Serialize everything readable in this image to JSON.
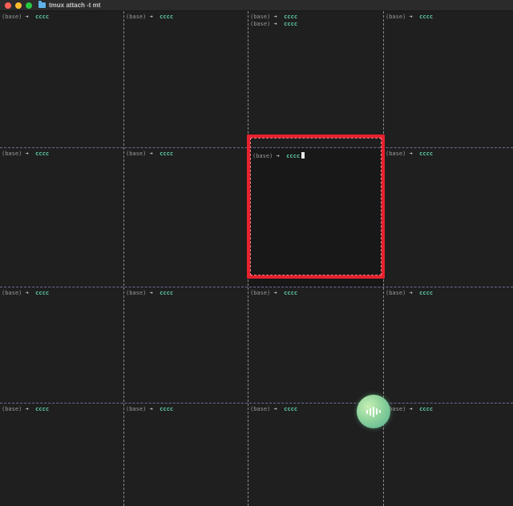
{
  "window": {
    "title": "tmux attach -t mt",
    "controls": [
      "close",
      "minimize",
      "zoom"
    ]
  },
  "prompt": {
    "env": "(base)",
    "arrow": "➜",
    "dir": "cccc"
  },
  "panes": [
    {
      "id": "r1c1",
      "lines": 1,
      "active": false
    },
    {
      "id": "r1c2",
      "lines": 1,
      "active": false
    },
    {
      "id": "r1c3",
      "lines": 2,
      "active": false
    },
    {
      "id": "r1c4",
      "lines": 1,
      "active": false
    },
    {
      "id": "r2c1",
      "lines": 1,
      "active": false
    },
    {
      "id": "r2c2",
      "lines": 1,
      "active": false
    },
    {
      "id": "r2c3",
      "lines": 1,
      "active": true
    },
    {
      "id": "r2c4",
      "lines": 1,
      "active": false
    },
    {
      "id": "r3c1",
      "lines": 1,
      "active": false
    },
    {
      "id": "r3c2",
      "lines": 1,
      "active": false
    },
    {
      "id": "r3c3",
      "lines": 1,
      "active": false
    },
    {
      "id": "r3c4",
      "lines": 1,
      "active": false
    },
    {
      "id": "r4c1",
      "lines": 1,
      "active": false
    },
    {
      "id": "r4c2",
      "lines": 1,
      "active": false
    },
    {
      "id": "r4c3",
      "lines": 1,
      "active": false
    },
    {
      "id": "r4c4",
      "lines": 1,
      "active": false
    }
  ],
  "colors": {
    "active_border": "#e8212e",
    "prompt_dir": "#5fd0a8",
    "background": "#1f1f1f"
  },
  "icons": {
    "folder": "folder-icon",
    "voice": "waveform-icon"
  }
}
